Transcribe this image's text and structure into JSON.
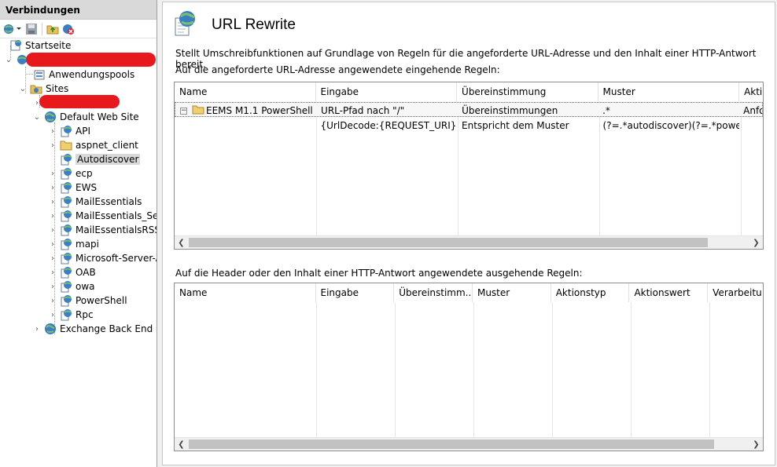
{
  "connections": {
    "header": "Verbindungen",
    "toolbar_icons": [
      "connect-icon",
      "save-icon",
      "up-folder-icon",
      "disconnect-icon"
    ],
    "tree": [
      {
        "label": "Startseite",
        "icon": "start-page-icon"
      },
      {
        "label": "",
        "icon": "server-icon",
        "redacted": true
      },
      {
        "label": "Anwendungspools",
        "icon": "app-pools-icon"
      },
      {
        "label": "Sites",
        "icon": "sites-folder-icon"
      },
      {
        "label": "",
        "icon": "site-icon",
        "redacted": true
      },
      {
        "label": "Default Web Site",
        "icon": "globe-icon"
      },
      {
        "label": "API",
        "icon": "web-app-icon"
      },
      {
        "label": "aspnet_client",
        "icon": "folder-icon"
      },
      {
        "label": "Autodiscover",
        "icon": "web-app-icon",
        "selected": true
      },
      {
        "label": "ecp",
        "icon": "web-app-icon"
      },
      {
        "label": "EWS",
        "icon": "web-app-icon"
      },
      {
        "label": "MailEssentials",
        "icon": "web-app-icon"
      },
      {
        "label": "MailEssentials_Serv",
        "icon": "web-app-icon"
      },
      {
        "label": "MailEssentialsRSS",
        "icon": "web-app-icon"
      },
      {
        "label": "mapi",
        "icon": "web-app-icon"
      },
      {
        "label": "Microsoft-Server-A",
        "icon": "web-app-icon"
      },
      {
        "label": "OAB",
        "icon": "web-app-icon"
      },
      {
        "label": "owa",
        "icon": "web-app-icon"
      },
      {
        "label": "PowerShell",
        "icon": "web-app-icon"
      },
      {
        "label": "Rpc",
        "icon": "web-app-icon"
      },
      {
        "label": "Exchange Back End",
        "icon": "globe-icon"
      }
    ]
  },
  "page": {
    "title": "URL Rewrite",
    "description": "Stellt Umschreibfunktionen auf Grundlage von Regeln für die angeforderte URL-Adresse und den Inhalt einer HTTP-Antwort bereit.",
    "inbound_heading": "Auf die angeforderte URL-Adresse angewendete eingehende Regeln:",
    "outbound_heading": "Auf die Header oder den Inhalt einer HTTP-Antwort angewendete ausgehende Regeln:"
  },
  "inbound": {
    "columns": [
      "Name",
      "Eingabe",
      "Übereinstimmung",
      "Muster",
      "Akti"
    ],
    "rows": [
      {
        "name": "EEMS M1.1 PowerShell ...",
        "eingabe": "URL-Pfad nach \"/\"",
        "uebereinstimmung": "Übereinstimmungen",
        "muster": ".*",
        "aktion": "Anfo"
      },
      {
        "name": "",
        "eingabe": "{UrlDecode:{REQUEST_URI}}",
        "uebereinstimmung": "Entspricht dem Muster",
        "muster": "(?=.*autodiscover)(?=.*power...",
        "aktion": ""
      }
    ]
  },
  "outbound": {
    "columns": [
      "Name",
      "Eingabe",
      "Übereinstimm...",
      "Muster",
      "Aktionstyp",
      "Aktionswert",
      "Verarbeitu..."
    ]
  },
  "colors": {
    "pane_header": "#d9d9d9",
    "selection": "#d9d9d9",
    "redaction": "#e8191c"
  }
}
